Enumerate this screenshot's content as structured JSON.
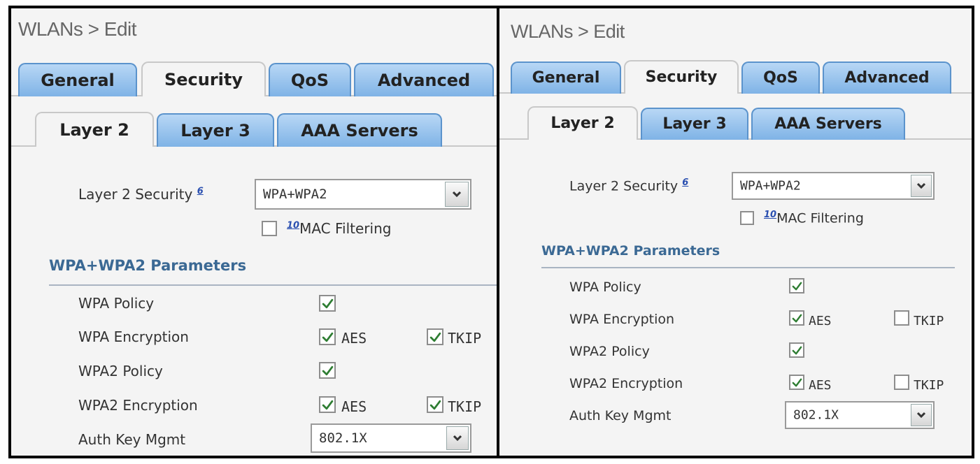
{
  "panels": [
    {
      "title": "WLANs > Edit",
      "tabs": [
        "General",
        "Security",
        "QoS",
        "Advanced"
      ],
      "active_tab": "Security",
      "subtabs": [
        "Layer 2",
        "Layer 3",
        "AAA Servers"
      ],
      "active_subtab": "Layer 2",
      "layer2_security": {
        "label": "Layer 2 Security",
        "help": "6",
        "value": "WPA+WPA2"
      },
      "mac_filtering": {
        "help": "10",
        "label": "MAC Filtering",
        "checked": false
      },
      "section_title": "WPA+WPA2 Parameters",
      "rows": {
        "wpa_policy": {
          "label": "WPA Policy",
          "checked": true
        },
        "wpa_encryption": {
          "label": "WPA Encryption",
          "aes_label": "AES",
          "aes_checked": true,
          "tkip_label": "TKIP",
          "tkip_checked": true
        },
        "wpa2_policy": {
          "label": "WPA2 Policy",
          "checked": true
        },
        "wpa2_encryption": {
          "label": "WPA2 Encryption",
          "aes_label": "AES",
          "aes_checked": true,
          "tkip_label": "TKIP",
          "tkip_checked": true
        },
        "auth_key_mgmt": {
          "label": "Auth Key Mgmt",
          "value": "802.1X"
        }
      }
    },
    {
      "title": "WLANs > Edit",
      "tabs": [
        "General",
        "Security",
        "QoS",
        "Advanced"
      ],
      "active_tab": "Security",
      "subtabs": [
        "Layer 2",
        "Layer 3",
        "AAA Servers"
      ],
      "active_subtab": "Layer 2",
      "layer2_security": {
        "label": "Layer 2 Security",
        "help": "6",
        "value": "WPA+WPA2"
      },
      "mac_filtering": {
        "help": "10",
        "label": "MAC Filtering",
        "checked": false
      },
      "section_title": "WPA+WPA2 Parameters",
      "rows": {
        "wpa_policy": {
          "label": "WPA Policy",
          "checked": true
        },
        "wpa_encryption": {
          "label": "WPA Encryption",
          "aes_label": "AES",
          "aes_checked": true,
          "tkip_label": "TKIP",
          "tkip_checked": false
        },
        "wpa2_policy": {
          "label": "WPA2 Policy",
          "checked": true
        },
        "wpa2_encryption": {
          "label": "WPA2 Encryption",
          "aes_label": "AES",
          "aes_checked": true,
          "tkip_label": "TKIP",
          "tkip_checked": false
        },
        "auth_key_mgmt": {
          "label": "Auth Key Mgmt",
          "value": "802.1X"
        }
      }
    }
  ],
  "colors": {
    "tab_blue": "#7fb3e6",
    "section_blue": "#3b6994",
    "help_link": "#2a4fb0",
    "check_green": "#2e7d32"
  },
  "icons": {
    "check": "check-icon",
    "dropdown": "chevron-down-icon"
  }
}
